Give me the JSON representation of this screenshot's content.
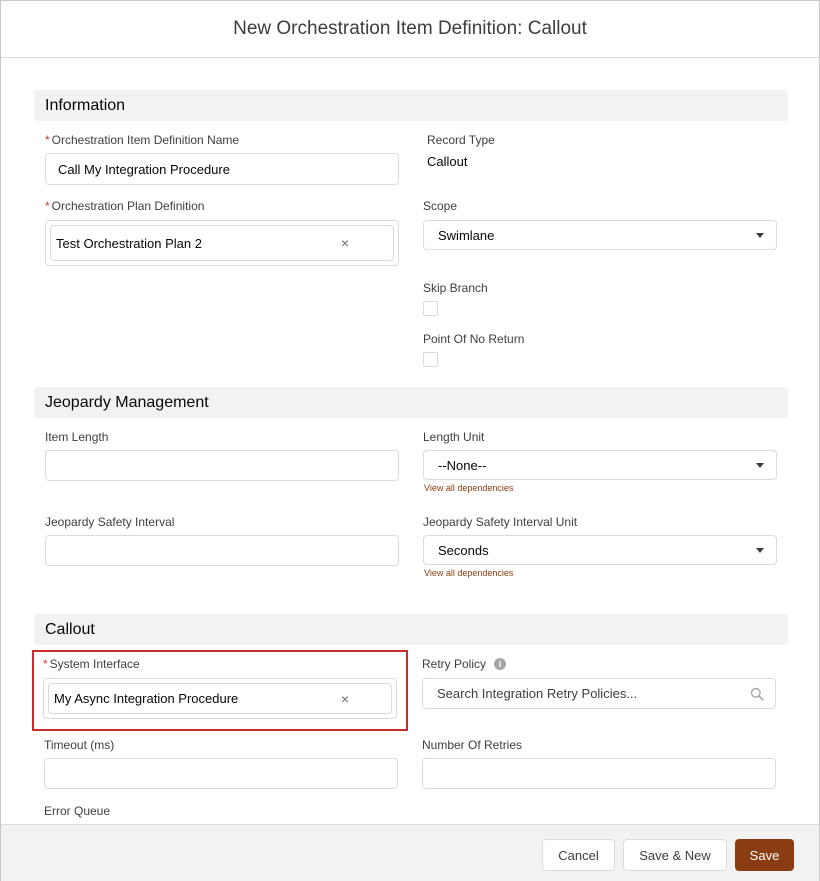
{
  "modal": {
    "title": "New Orchestration Item Definition: Callout"
  },
  "colors": {
    "brand": "#8a3d12",
    "required": "#c23934",
    "highlight": "#c82c2c"
  },
  "sections": {
    "information": {
      "title": "Information",
      "name_label": "Orchestration Item Definition Name",
      "name_value": "Call My Integration Procedure",
      "record_type_label": "Record Type",
      "record_type_value": "Callout",
      "plan_def_label": "Orchestration Plan Definition",
      "plan_def_value": "Test Orchestration Plan 2",
      "scope_label": "Scope",
      "scope_value": "Swimlane",
      "skip_branch_label": "Skip Branch",
      "point_of_no_return_label": "Point Of No Return"
    },
    "jeopardy": {
      "title": "Jeopardy Management",
      "item_length_label": "Item Length",
      "item_length_value": "",
      "length_unit_label": "Length Unit",
      "length_unit_value": "--None--",
      "dependencies_link": "View all dependencies",
      "safety_interval_label": "Jeopardy Safety Interval",
      "safety_interval_value": "",
      "safety_unit_label": "Jeopardy Safety Interval Unit",
      "safety_unit_value": "Seconds"
    },
    "callout": {
      "title": "Callout",
      "system_interface_label": "System Interface",
      "system_interface_value": "My Async Integration Procedure",
      "retry_policy_label": "Retry Policy",
      "retry_policy_placeholder": "Search Integration Retry Policies...",
      "timeout_label": "Timeout (ms)",
      "timeout_value": "",
      "retries_label": "Number Of Retries",
      "retries_value": "",
      "error_queue_label": "Error Queue"
    }
  },
  "footer": {
    "cancel": "Cancel",
    "save_new": "Save & New",
    "save": "Save"
  },
  "icons": {
    "clear": "×",
    "info": "i",
    "required_marker": "*"
  }
}
